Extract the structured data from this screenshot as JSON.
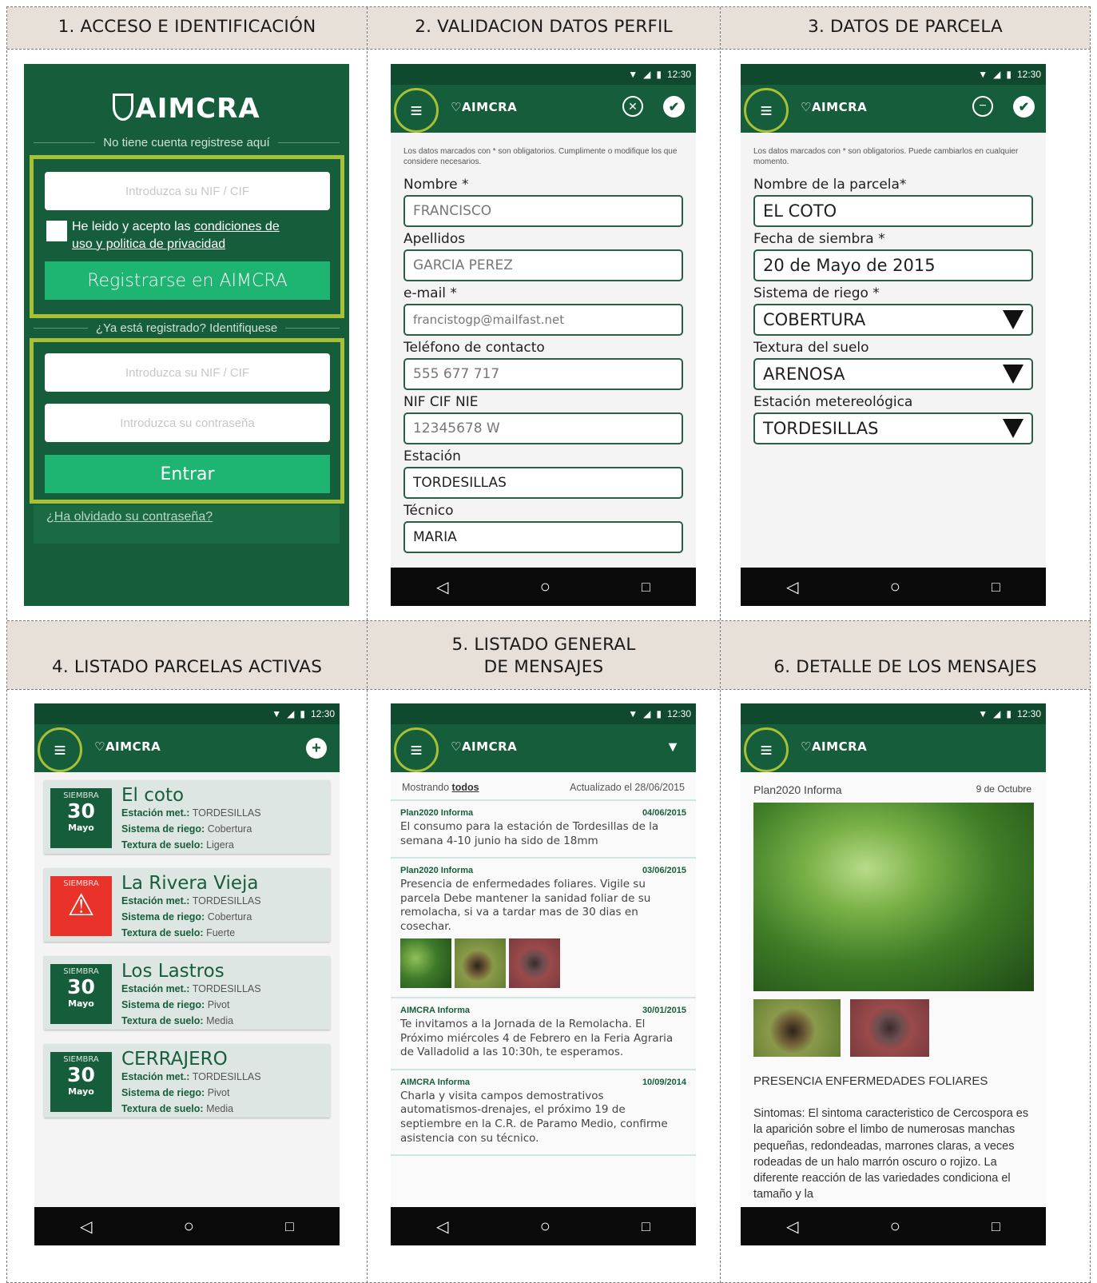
{
  "headers": [
    "1.   ACCESO E IDENTIFICACIÓN",
    "2.   VALIDACION DATOS PERFIL",
    "3.   DATOS DE PARCELA",
    "4.   LISTADO PARCELAS ACTIVAS",
    "5.   LISTADO GENERAL",
    "DE MENSAJES",
    "6.   DETALLE DE LOS MENSAJES"
  ],
  "status_time": "12:30",
  "logo": "AIMCRA",
  "colors": {
    "green_dark": "#165e3b",
    "green_status": "#0f4a2e",
    "accent_ring": "#a7c035",
    "button_green": "#1eb472",
    "alert_red": "#e8322a"
  },
  "login": {
    "no_account": "No tiene cuenta registrese aquí",
    "nif_placeholder": "Introduzca su NIF / CIF",
    "terms_prefix": "He leido y acepto las",
    "terms_link1": "condiciones de",
    "terms_link2": "uso y politica de privacidad",
    "register_button": "Registrarse en AIMCRA",
    "already": "¿Ya está registrado? Identifiquese",
    "nif_placeholder2": "Introduzca su NIF / CIF",
    "password_placeholder": "Introduzca su contraseña",
    "enter_button": "Entrar",
    "forgot": "¿Ha olvidado su contraseña?"
  },
  "profile": {
    "hint": "Los datos marcados con * son obligatorios. Cumplimente o modifique los que considere necesarios.",
    "fields": [
      {
        "label": "Nombre *",
        "value": "FRANCISCO"
      },
      {
        "label": "Apellidos",
        "value": "GARCIA PEREZ"
      },
      {
        "label": "e-mail *",
        "value": "francistogp@mailfast.net"
      },
      {
        "label": "Teléfono de contacto",
        "value": "555 677 717"
      },
      {
        "label": "NIF CIF NIE",
        "value": "12345678 W"
      },
      {
        "label": "Estación",
        "value": "TORDESILLAS"
      },
      {
        "label": "Técnico",
        "value": "MARIA"
      }
    ]
  },
  "parcel": {
    "hint": "Los datos marcados con * son obligatorios. Puede cambiarlos en cualquier momento.",
    "fields": [
      {
        "label": "Nombre de la parcela*",
        "value": "EL COTO"
      },
      {
        "label": "Fecha de siembra *",
        "value": "20 de Mayo de 2015"
      },
      {
        "label": "Sistema de riego *",
        "value": "COBERTURA"
      },
      {
        "label": "Textura del suelo",
        "value": "ARENOSA"
      },
      {
        "label": "Estación metereológica",
        "value": "TORDESILLAS"
      }
    ]
  },
  "parcels": {
    "label_station": "Estación met.:",
    "label_irrigation": "Sistema de riego:",
    "label_soil": "Textura de suelo:",
    "items": [
      {
        "badge": "SIEMBRA",
        "day": "30",
        "month": "Mayo",
        "name": "El coto",
        "station": "TORDESILLAS",
        "irrigation": "Cobertura",
        "soil": "Ligera"
      },
      {
        "badge": "SIEMBRA",
        "day": "",
        "month": "",
        "name": "La Rivera Vieja",
        "station": "TORDESILLAS",
        "irrigation": "Cobertura",
        "soil": "Fuerte"
      },
      {
        "badge": "SIEMBRA",
        "day": "30",
        "month": "Mayo",
        "name": "Los Lastros",
        "station": "TORDESILLAS",
        "irrigation": "Pivot",
        "soil": "Media"
      },
      {
        "badge": "SIEMBRA",
        "day": "30",
        "month": "Mayo",
        "name": "CERRAJERO",
        "station": "TORDESILLAS",
        "irrigation": "Pivot",
        "soil": "Media"
      }
    ]
  },
  "messages": {
    "showing": "Mostrando",
    "showing_all": "todos",
    "updated": "Actualizado el 28/06/2015",
    "items": [
      {
        "from": "Plan2020 Informa",
        "date": "04/06/2015",
        "text": "El consumo para la estación de Tordesillas de la semana 4-10 junio ha sido de 18mm"
      },
      {
        "from": "Plan2020 Informa",
        "date": "03/06/2015",
        "text": "Presencia de enfermedades foliares. Vigile su parcela Debe mantener la sanidad foliar de su remolacha, si va a tardar mas de 30 dias en cosechar."
      },
      {
        "from": "AIMCRA Informa",
        "date": "30/01/2015",
        "text": "Te invitamos a la Jornada de la Remolacha. El Próximo miércoles 4 de Febrero en la Feria Agraria de Valladolid a las 10:30h, te esperamos."
      },
      {
        "from": "AIMCRA Informa",
        "date": "10/09/2014",
        "text": "Charla y visita campos demostrativos automatismos-drenajes, el próximo 19 de septiembre en la C.R. de Paramo Medio, confirme asistencia con su técnico."
      }
    ]
  },
  "detail": {
    "from": "Plan2020 Informa",
    "date": "9 de Octubre",
    "title": "PRESENCIA ENFERMEDADES FOLIARES",
    "text": "Sintomas: El sintoma caracteristico de Cercospora es la aparición sobre el limbo de numerosas manchas pequeñas, redondeadas, marrones claras, a veces rodeadas de un halo marrón oscuro o rojizo. La diferente reacción de las variedades condiciona el tamaño y la"
  }
}
